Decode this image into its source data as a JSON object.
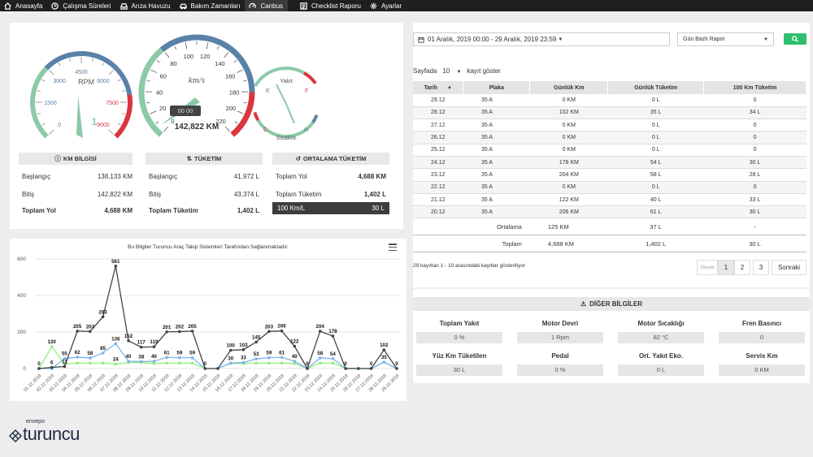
{
  "nav": {
    "items": [
      {
        "label": "Anasayfa",
        "icon": "home-icon"
      },
      {
        "label": "Çalışma Süreleri",
        "icon": "clock-icon"
      },
      {
        "label": "Arıza Havuzu",
        "icon": "inbox-icon"
      },
      {
        "label": "Bakım Zamanları",
        "icon": "car-icon"
      },
      {
        "label": "Canbus",
        "icon": "dashboard-icon"
      },
      {
        "label": "Checklist Raporu",
        "icon": "list-icon"
      },
      {
        "label": "Ayarlar",
        "icon": "gear-icon"
      }
    ],
    "active_index": 4
  },
  "gauges": {
    "rpm": {
      "unit": "RPM",
      "ticks": [
        "0",
        "1500",
        "3000",
        "4500",
        "6000",
        "7500",
        "9000"
      ],
      "value_label": "1",
      "max": 9000,
      "value": 1
    },
    "speed": {
      "unit": "km/s",
      "ticks": [
        "0",
        "20",
        "40",
        "60",
        "80",
        "100",
        "120",
        "140",
        "160",
        "180",
        "200",
        "220"
      ],
      "clock": "00 00",
      "odometer": "142,822 KM",
      "max": 220,
      "value": 0
    },
    "fuel": {
      "label": "Yakıt",
      "e": "E",
      "f": "F"
    },
    "temp": {
      "label": "Sıcaklık",
      "c": "C",
      "h": "H"
    }
  },
  "km_info": {
    "title": "KM BİLGİSİ",
    "rows": [
      {
        "label": "Başlangıç",
        "value": "138,133 KM"
      },
      {
        "label": "Bitiş",
        "value": "142,822 KM"
      },
      {
        "label": "Toplam Yol",
        "value": "4,688 KM"
      }
    ]
  },
  "consumption": {
    "title": "TÜKETİM",
    "rows": [
      {
        "label": "Başlangıç",
        "value": "41,972 L"
      },
      {
        "label": "Bitiş",
        "value": "43,374 L"
      },
      {
        "label": "Toplam Tüketim",
        "value": "1,402 L"
      }
    ]
  },
  "avg_consumption": {
    "title": "ORTALAMA TÜKETİM",
    "rows": [
      {
        "label": "Toplam Yol",
        "value": "4,688 KM"
      },
      {
        "label": "Toplam Tüketim",
        "value": "1,402 L"
      },
      {
        "label": "100 Km/L",
        "value": "30 L"
      }
    ]
  },
  "chart_data": {
    "type": "line",
    "title": "Bu Bilgiler Turuncu Araç Takip Sistemleri Tarafından Sağlanmaktadır.",
    "ylim": [
      0,
      600
    ],
    "yticks": [
      "0",
      "200",
      "400",
      "600"
    ],
    "categories": [
      "01.12.2019",
      "02.12.2019",
      "03.12.2019",
      "04.12.2019",
      "05.12.2019",
      "06.12.2019",
      "07.12.2019",
      "08.12.2019",
      "09.12.2019",
      "10.12.2019",
      "11.12.2019",
      "12.12.2019",
      "13.12.2019",
      "14.12.2019",
      "15.12.2019",
      "16.12.2019",
      "17.12.2019",
      "18.12.2019",
      "19.12.2019",
      "20.12.2019",
      "21.12.2019",
      "22.12.2019",
      "23.12.2019",
      "24.12.2019",
      "25.12.2019",
      "26.12.2019",
      "27.12.2019",
      "28.12.2019",
      "29.12.2019"
    ],
    "series": [
      {
        "color": "#444444",
        "values": [
          0,
          6,
          11,
          205,
          203,
          283,
          561,
          152,
          117,
          119,
          201,
          202,
          205,
          0,
          0,
          100,
          103,
          145,
          203,
          206,
          122,
          0,
          204,
          178,
          0,
          0,
          0,
          102,
          0
        ]
      },
      {
        "color": "#7cb5ec",
        "values": [
          0,
          0,
          55,
          62,
          58,
          85,
          136,
          40,
          38,
          40,
          61,
          59,
          59,
          0,
          0,
          30,
          33,
          53,
          59,
          61,
          40,
          0,
          58,
          54,
          0,
          0,
          0,
          35,
          0
        ]
      },
      {
        "color": "#90ed7d",
        "values": [
          0,
          120,
          24,
          30,
          30,
          30,
          24,
          33,
          33,
          28,
          30,
          30,
          30,
          0,
          0,
          28,
          28,
          30,
          30,
          30,
          28,
          0,
          30,
          30,
          0,
          0,
          0,
          35,
          0
        ]
      }
    ],
    "labels": [
      {
        "i": 0,
        "v": "0",
        "s": 0
      },
      {
        "i": 1,
        "v": "6",
        "s": 0
      },
      {
        "i": 2,
        "v": "11",
        "s": 0
      },
      {
        "i": 3,
        "v": "205",
        "s": 0
      },
      {
        "i": 4,
        "v": "203",
        "s": 0
      },
      {
        "i": 5,
        "v": "283",
        "s": 0
      },
      {
        "i": 6,
        "v": "561",
        "s": 0
      },
      {
        "i": 7,
        "v": "152",
        "s": 0
      },
      {
        "i": 8,
        "v": "117",
        "s": 0
      },
      {
        "i": 9,
        "v": "119",
        "s": 0
      },
      {
        "i": 10,
        "v": "201",
        "s": 0
      },
      {
        "i": 11,
        "v": "202",
        "s": 0
      },
      {
        "i": 12,
        "v": "205",
        "s": 0
      },
      {
        "i": 13,
        "v": "0",
        "s": 0
      },
      {
        "i": 15,
        "v": "100",
        "s": 0
      },
      {
        "i": 16,
        "v": "103",
        "s": 0
      },
      {
        "i": 17,
        "v": "145",
        "s": 0
      },
      {
        "i": 18,
        "v": "203",
        "s": 0
      },
      {
        "i": 19,
        "v": "206",
        "s": 0
      },
      {
        "i": 20,
        "v": "122",
        "s": 0
      },
      {
        "i": 21,
        "v": "0",
        "s": 0
      },
      {
        "i": 22,
        "v": "204",
        "s": 0
      },
      {
        "i": 23,
        "v": "178",
        "s": 0
      },
      {
        "i": 24,
        "v": "0",
        "s": 0
      },
      {
        "i": 26,
        "v": "0",
        "s": 0
      },
      {
        "i": 27,
        "v": "102",
        "s": 0
      },
      {
        "i": 28,
        "v": "0",
        "s": 0
      },
      {
        "i": 1,
        "v": "120",
        "s": 2
      },
      {
        "i": 2,
        "v": "55",
        "s": 1
      },
      {
        "i": 3,
        "v": "62",
        "s": 1
      },
      {
        "i": 4,
        "v": "58",
        "s": 1
      },
      {
        "i": 5,
        "v": "85",
        "s": 1
      },
      {
        "i": 6,
        "v": "136",
        "s": 1
      },
      {
        "i": 6,
        "v": "24",
        "s": 2
      },
      {
        "i": 7,
        "v": "40",
        "s": 1
      },
      {
        "i": 8,
        "v": "38",
        "s": 1
      },
      {
        "i": 9,
        "v": "40",
        "s": 1
      },
      {
        "i": 10,
        "v": "61",
        "s": 1
      },
      {
        "i": 11,
        "v": "59",
        "s": 1
      },
      {
        "i": 12,
        "v": "59",
        "s": 1
      },
      {
        "i": 15,
        "v": "30",
        "s": 1
      },
      {
        "i": 16,
        "v": "33",
        "s": 1
      },
      {
        "i": 17,
        "v": "53",
        "s": 1
      },
      {
        "i": 18,
        "v": "59",
        "s": 1
      },
      {
        "i": 19,
        "v": "61",
        "s": 1
      },
      {
        "i": 20,
        "v": "40",
        "s": 1
      },
      {
        "i": 22,
        "v": "58",
        "s": 1
      },
      {
        "i": 23,
        "v": "54",
        "s": 1
      },
      {
        "i": 27,
        "v": "35",
        "s": 1
      }
    ],
    "grid": true,
    "legend": "none"
  },
  "report": {
    "date_range": "01 Aralık, 2019 00:00 - 29 Aralık, 2019 23:59",
    "report_type": "Gün Bazlı Rapor",
    "page_size_prefix": "Sayfada",
    "page_size": "10",
    "page_size_suffix": "kayıt göster",
    "columns": [
      "Tarih",
      "Plaka",
      "Günlük Km",
      "Günlük Tüketim",
      "100 Km Tüketim"
    ],
    "rows": [
      [
        "29.12",
        "35 A",
        "0 KM",
        "0 L",
        "0"
      ],
      [
        "28.12",
        "35 A",
        "102 KM",
        "35 L",
        "34 L"
      ],
      [
        "27.12",
        "35 A",
        "0 KM",
        "0 L",
        "0"
      ],
      [
        "26.12",
        "35 A",
        "0 KM",
        "0 L",
        "0"
      ],
      [
        "25.12",
        "35 A",
        "0 KM",
        "0 L",
        "0"
      ],
      [
        "24.12",
        "35 A",
        "178 KM",
        "54 L",
        "30 L"
      ],
      [
        "23.12",
        "35 A",
        "204 KM",
        "58 L",
        "28 L"
      ],
      [
        "22.12",
        "35 A",
        "0 KM",
        "0 L",
        "0"
      ],
      [
        "21.12",
        "35 A",
        "122 KM",
        "40 L",
        "33 L"
      ],
      [
        "20.12",
        "35 A",
        "206 KM",
        "61 L",
        "30 L"
      ]
    ],
    "average": {
      "label": "Ortalama",
      "km": "125 KM",
      "cons": "37 L",
      "per100": "-"
    },
    "total": {
      "label": "Toplam",
      "km": "4,688 KM",
      "cons": "1,402 L",
      "per100": "30 L"
    },
    "footer": "29 kayıttan 1 - 10 arasındaki kayıtlar gösteriliyor",
    "pager": {
      "prev": "Önceki",
      "pages": [
        "1",
        "2",
        "3"
      ],
      "next": "Sonraki"
    }
  },
  "other_info": {
    "title": "DİĞER BİLGİLER",
    "items": [
      {
        "label": "Toplam Yakıt",
        "value": "0 %"
      },
      {
        "label": "Motor Devri",
        "value": "1 Rpm"
      },
      {
        "label": "Motor Sıcaklığı",
        "value": "82 °C"
      },
      {
        "label": "Fren Basıncı",
        "value": "0"
      },
      {
        "label": "Yüz Km Tüketilen",
        "value": "30 L"
      },
      {
        "label": "Pedal",
        "value": "0 %"
      },
      {
        "label": "Ort. Yakıt Eko.",
        "value": "0 L"
      },
      {
        "label": "Servis Km",
        "value": "0 KM"
      }
    ]
  },
  "brand": {
    "small": "envepo",
    "name": "turuncu",
    "color": "#1d2a44"
  }
}
